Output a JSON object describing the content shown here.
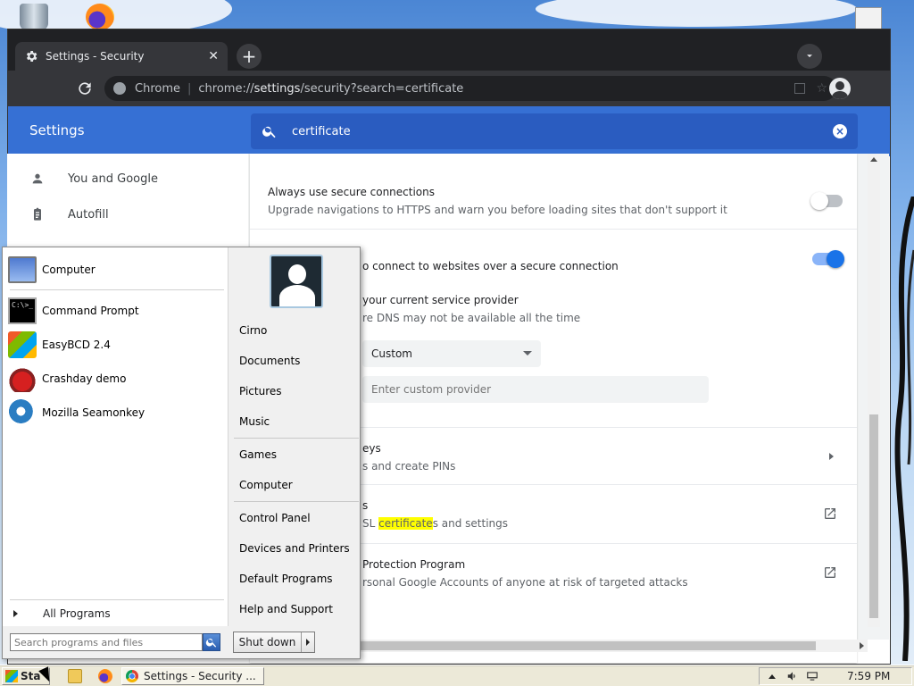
{
  "browser": {
    "tab_title": "Settings - Security",
    "omnibox_site": "Chrome",
    "url_scheme": "chrome://",
    "url_host": "settings",
    "url_path": "/security?search=certificate"
  },
  "settings": {
    "title": "Settings",
    "search_value": "certificate",
    "nav": [
      {
        "label": "You and Google",
        "icon": "person-icon"
      },
      {
        "label": "Autofill",
        "icon": "clipboard-icon"
      }
    ],
    "rows": {
      "secure_conn_title": "Always use secure connections",
      "secure_conn_sub": "Upgrade navigations to HTTPS and warn you before loading sites that don't support it",
      "secure_conn_on": false,
      "dns_sub": "o connect to websites over a secure connection",
      "dns_on": true,
      "provider_title": "your current service provider",
      "provider_sub": "re DNS may not be available all the time",
      "provider_select": "Custom",
      "custom_placeholder": "Enter custom provider",
      "keys_title": "eys",
      "keys_sub": "s and create PINs",
      "certs_title": "s",
      "certs_sub_prefix": "SL ",
      "certs_sub_highlight": "certificate",
      "certs_sub_suffix": "s and settings",
      "app_title": "Protection Program",
      "app_sub": "rsonal Google Accounts of anyone at risk of targeted attacks"
    }
  },
  "startmenu": {
    "left_items": [
      "Computer",
      "Command Prompt",
      "EasyBCD 2.4",
      "Crashday demo",
      "Mozilla Seamonkey"
    ],
    "all_programs": "All Programs",
    "search_placeholder": "Search programs and files",
    "right_items_1": [
      "Cirno",
      "Documents",
      "Pictures",
      "Music"
    ],
    "right_items_2": [
      "Games",
      "Computer"
    ],
    "right_items_3": [
      "Control Panel",
      "Devices and Printers",
      "Default Programs",
      "Help and Support"
    ],
    "shutdown": "Shut down",
    "cmd_icon_text": "C:\\>_"
  },
  "taskbar": {
    "start_label": "Sta",
    "task_chrome_label": "Settings - Security ...",
    "clock": "7:59 PM"
  }
}
